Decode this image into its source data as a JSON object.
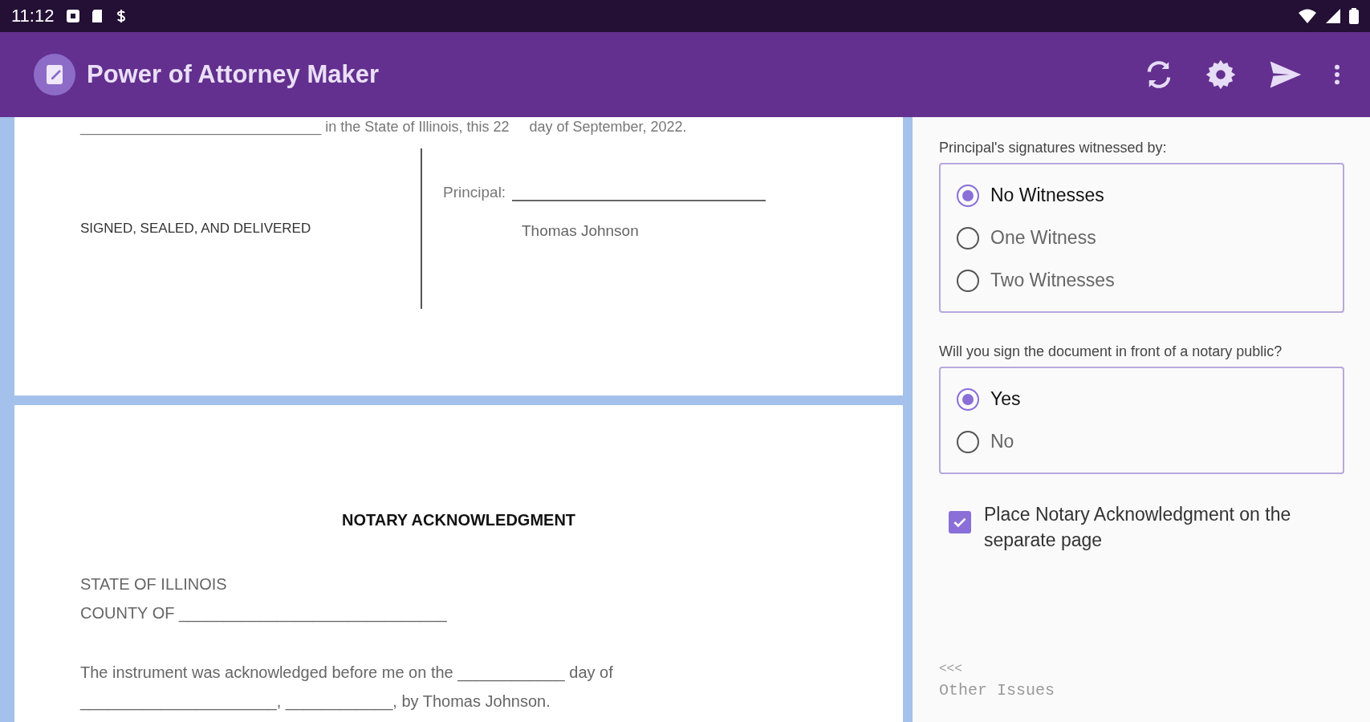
{
  "status_bar": {
    "time": "11:12"
  },
  "app_bar": {
    "title": "Power of Attorney Maker"
  },
  "document": {
    "cut_line": "______________________________ in the State of Illinois, this 22     day of September, 2022.",
    "signature": {
      "statement": "SIGNED, SEALED, AND DELIVERED",
      "principal_label": "Principal:",
      "principal_name": "Thomas Johnson"
    },
    "notary": {
      "heading": "NOTARY ACKNOWLEDGMENT",
      "state": "STATE OF ILLINOIS",
      "county": "COUNTY OF ______________________________",
      "line_1": "The instrument was acknowledged before me on the ____________ day of",
      "line_2": "______________________, ____________, by Thomas Johnson."
    }
  },
  "questions": [
    {
      "label": "Principal's signatures witnessed by:",
      "options": [
        {
          "label": "No Witnesses",
          "selected": true
        },
        {
          "label": "One Witness",
          "selected": false
        },
        {
          "label": "Two Witnesses",
          "selected": false
        }
      ]
    },
    {
      "label": "Will you sign the document in front of a notary public?",
      "options": [
        {
          "label": "Yes",
          "selected": true
        },
        {
          "label": "No",
          "selected": false
        }
      ]
    }
  ],
  "checkbox": {
    "label": "Place Notary Acknowledgment on the separate page",
    "checked": true
  },
  "back_nav": {
    "arrow": "<<<",
    "label": "Other Issues"
  }
}
